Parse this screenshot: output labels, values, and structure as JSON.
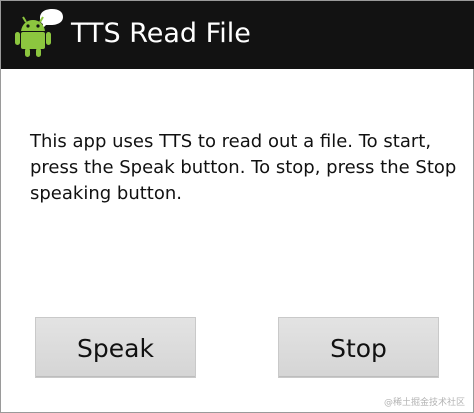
{
  "app": {
    "title": "TTS Read File",
    "icon": "android-robot-icon"
  },
  "main": {
    "instructions": "This app uses TTS to read out a file. To start, press the Speak button. To stop, press the Stop speaking button."
  },
  "buttons": {
    "speak_label": "Speak",
    "stop_label": "Stop"
  },
  "watermark": {
    "text": "@稀土掘金技术社区"
  },
  "colors": {
    "action_bar": "#121212",
    "background": "#ffffff",
    "button": "#dddddd",
    "android_green": "#8cc63f"
  }
}
